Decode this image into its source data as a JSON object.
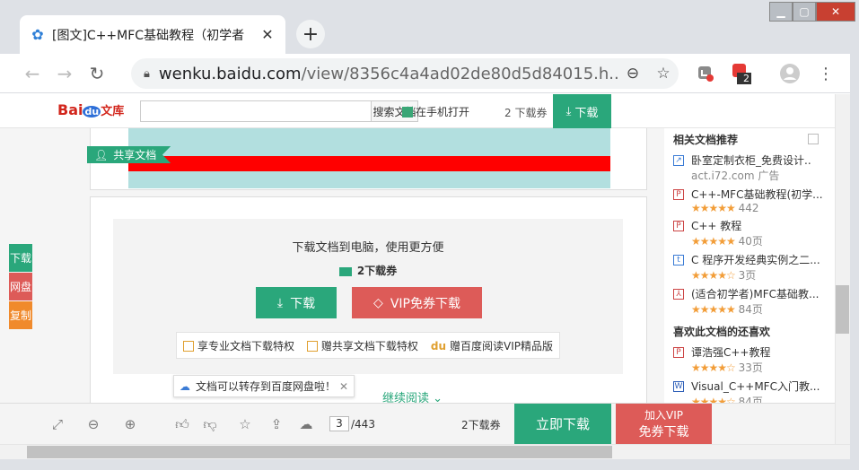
{
  "window": {
    "tab_title": "[图文]C++MFC基础教程（初学者",
    "close_tab": "✕",
    "new_tab": "+",
    "min": "▁",
    "max": "▢",
    "close": "✕"
  },
  "toolbar": {
    "url_host": "wenku.baidu.com",
    "url_path": "/view/8356c4a4ad02de80d5d84015.h...",
    "ext_badge": "2"
  },
  "baidu": {
    "logo_bai": "Bai",
    "logo_du": "du",
    "logo_ku": "文库",
    "search_btn": "搜索文档",
    "phone_open": "在手机打开",
    "download_count": "2 下载券",
    "download_btn": "下载"
  },
  "doc": {
    "share_tag": "共享文档"
  },
  "download_panel": {
    "text": "下载文档到电脑，使用更方便",
    "cost": "2下载券",
    "btn_download": "下载",
    "btn_vip": "VIP免券下载",
    "perks": [
      "享专业文档下载特权",
      "赠共享文档下载特权",
      "赠百度阅读VIP精品版"
    ],
    "toast": "文档可以转存到百度网盘啦！",
    "continue": "继续阅读"
  },
  "rail": [
    "下载",
    "网盘",
    "复制"
  ],
  "sidebar": {
    "section1": "相关文档推荐",
    "items1": [
      {
        "title": "卧室定制衣柜_免费设计..",
        "meta": "act.i72.com    广告"
      },
      {
        "title": "C++-MFC基础教程(初学...",
        "stars": "★★★★★",
        "meta": "442"
      },
      {
        "title": "C++ 教程",
        "stars": "★★★★★",
        "meta": "40页"
      },
      {
        "title": "C 程序开发经典实例之二...",
        "stars": "★★★★☆",
        "meta": "3页"
      },
      {
        "title": "(适合初学者)MFC基础教...",
        "stars": "★★★★★",
        "meta": "84页"
      }
    ],
    "section2": "喜欢此文档的还喜欢",
    "items2": [
      {
        "title": "谭浩强C++教程",
        "stars": "★★★★☆",
        "meta": "33页"
      },
      {
        "title": "Visual_C++MFC入门教...",
        "stars": "★★★★☆",
        "meta": "84页"
      }
    ]
  },
  "bottombar": {
    "page_current": "3",
    "page_total": "/443",
    "count": "2下载券",
    "btn_download": "立即下载",
    "vip_l1": "加入VIP",
    "vip_l2": "免券下载"
  },
  "colors": {
    "accent_green": "#2aa77b",
    "accent_red": "#dd5b58"
  }
}
